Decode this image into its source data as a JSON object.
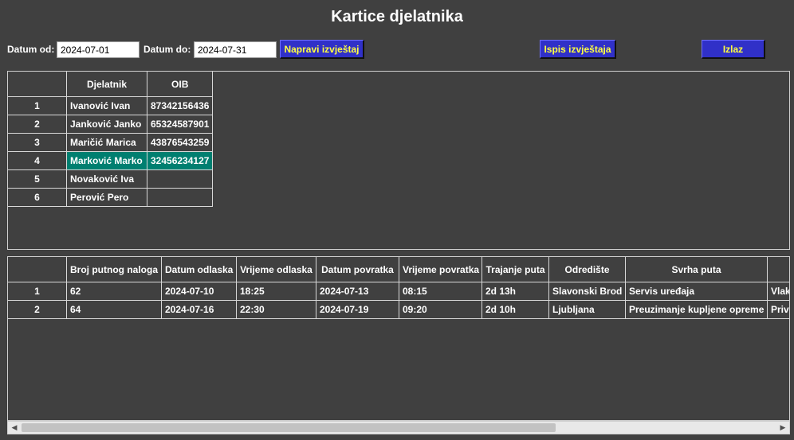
{
  "title": "Kartice djelatnika",
  "filters": {
    "date_from_label": "Datum od:",
    "date_from_value": "2024-07-01",
    "date_to_label": "Datum do:",
    "date_to_value": "2024-07-31"
  },
  "buttons": {
    "create_report": "Napravi izvještaj",
    "print_report": "Ispis izvještaja",
    "exit": "Izlaz"
  },
  "colors": {
    "background": "#404040",
    "button_bg": "#3030c8",
    "button_text": "#ffff40",
    "selected_cell": "#007f70"
  },
  "employees": {
    "headers": [
      "",
      "Djelatnik",
      "OIB"
    ],
    "rows": [
      {
        "n": "1",
        "name": "Ivanović Ivan",
        "oib": "87342156436"
      },
      {
        "n": "2",
        "name": "Janković Janko",
        "oib": "65324587901"
      },
      {
        "n": "3",
        "name": "Maričić Marica",
        "oib": "43876543259"
      },
      {
        "n": "4",
        "name": "Marković Marko",
        "oib": "32456234127"
      },
      {
        "n": "5",
        "name": "Novaković Iva",
        "oib": ""
      },
      {
        "n": "6",
        "name": "Perović Pero",
        "oib": ""
      }
    ],
    "selected_row": 3
  },
  "trips": {
    "headers": [
      "",
      "Broj putnog naloga",
      "Datum odlaska",
      "Vrijeme odlaska",
      "Datum povratka",
      "Vrijeme povratka",
      "Trajanje puta",
      "Odredište",
      "Svrha puta",
      ""
    ],
    "rows": [
      {
        "n": "1",
        "nalog": "62",
        "datum_odlaska": "2024-07-10",
        "vrijeme_odlaska": "18:25",
        "datum_povratka": "2024-07-13",
        "vrijeme_povratka": "08:15",
        "trajanje": "2d 13h",
        "odrediste": "Slavonski Brod",
        "svrha": "Servis uređaja",
        "extra": "Vlak"
      },
      {
        "n": "2",
        "nalog": "64",
        "datum_odlaska": "2024-07-16",
        "vrijeme_odlaska": "22:30",
        "datum_povratka": "2024-07-19",
        "vrijeme_povratka": "09:20",
        "trajanje": "2d 10h",
        "odrediste": "Ljubljana",
        "svrha": "Preuzimanje kupljene opreme",
        "extra": "Priva"
      }
    ]
  },
  "scrollbar": {
    "left_arrow_icon": "arrow-left-icon",
    "right_arrow_icon": "arrow-right-icon"
  }
}
